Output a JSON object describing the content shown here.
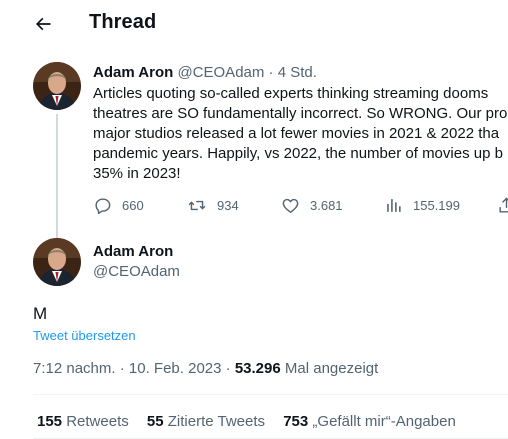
{
  "header": {
    "title": "Thread"
  },
  "parent_tweet": {
    "name": "Adam Aron",
    "handle": "@CEOAdam",
    "separator": "·",
    "time": "4 Std.",
    "text_lines": [
      "Articles quoting so-called experts thinking streaming dooms",
      "theatres are SO fundamentally incorrect. So WRONG. Our pro",
      "major studios released a lot fewer movies in 2021 & 2022 tha",
      "pandemic years. Happily, vs 2022, the number of movies up b",
      "35% in 2023!"
    ],
    "actions": {
      "replies": "660",
      "retweets": "934",
      "likes": "3.681",
      "views": "155.199"
    }
  },
  "main_tweet": {
    "name": "Adam Aron",
    "handle": "@CEOAdam",
    "text": "M",
    "translate_label": "Tweet übersetzen",
    "time": "7:12 nachm.",
    "separator": "·",
    "date": "10. Feb. 2023",
    "views_count": "53.296",
    "views_label": "Mal angezeigt",
    "stats": {
      "retweets_count": "155",
      "retweets_label": "Retweets",
      "quotes_count": "55",
      "quotes_label": "Zitierte Tweets",
      "likes_count": "753",
      "likes_label": "„Gefällt mir“-Angaben"
    }
  },
  "colors": {
    "text": "#0f1419",
    "muted": "#536471",
    "link": "#1d9bf0",
    "divider": "#eff3f4",
    "thread_line": "#cfd9de"
  },
  "icons": [
    "back-arrow-icon",
    "reply-icon",
    "retweet-icon",
    "like-icon",
    "views-icon",
    "share-icon"
  ]
}
